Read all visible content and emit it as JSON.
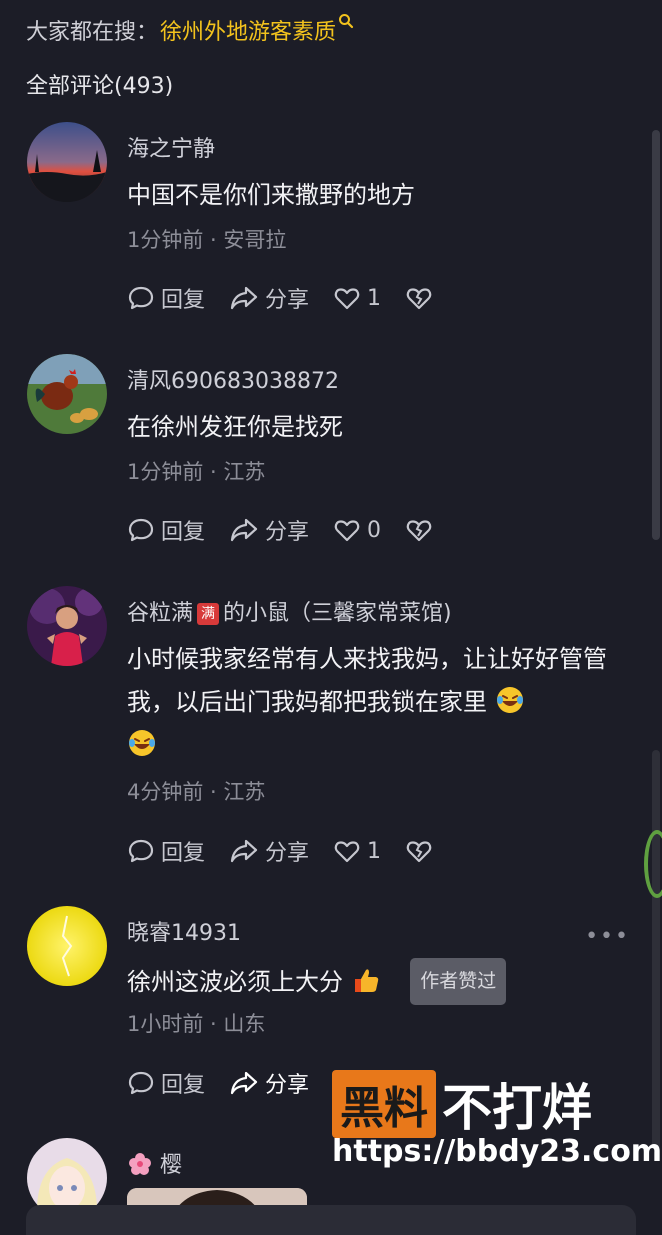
{
  "search_bar": {
    "prefix": "大家都在搜：",
    "keyword": "徐州外地游客素质"
  },
  "comments_header": {
    "label": "全部评论(493)"
  },
  "comments": [
    {
      "user": "海之宁静",
      "text": "中国不是你们来撒野的地方",
      "meta": "1分钟前 · 安哥拉",
      "reply": "回复",
      "share": "分享",
      "likes": "1"
    },
    {
      "user": "清风690683038872",
      "text": "在徐州发狂你是找死",
      "meta": "1分钟前 · 江苏",
      "reply": "回复",
      "share": "分享",
      "likes": "0"
    },
    {
      "user_part1": "谷粒满",
      "user_badge": "满",
      "user_part2": "的小鼠（三馨家常菜馆)",
      "text": "小时候我家经常有人来找我妈，让让好好管管我，以后出门我妈都把我锁在家里",
      "meta": "4分钟前 · 江苏",
      "reply": "回复",
      "share": "分享",
      "likes": "1"
    },
    {
      "user": "晓睿14931",
      "text": "徐州这波必须上大分",
      "author_tag": "作者赞过",
      "meta": "1小时前 · 山东",
      "reply": "回复",
      "share": "分享",
      "more": "•••"
    },
    {
      "user": "樱"
    }
  ],
  "watermark": {
    "box_text": "黑料",
    "rest_text": "不打烊",
    "url": "https://bbdy23.com"
  },
  "colors": {
    "background": "#1c1d27",
    "keyword": "#f2c21d",
    "watermark_orange": "#e8781a"
  },
  "icons": [
    "search-icon",
    "comment-bubble-icon",
    "share-arrow-icon",
    "heart-icon",
    "broken-heart-icon",
    "more-icon"
  ]
}
